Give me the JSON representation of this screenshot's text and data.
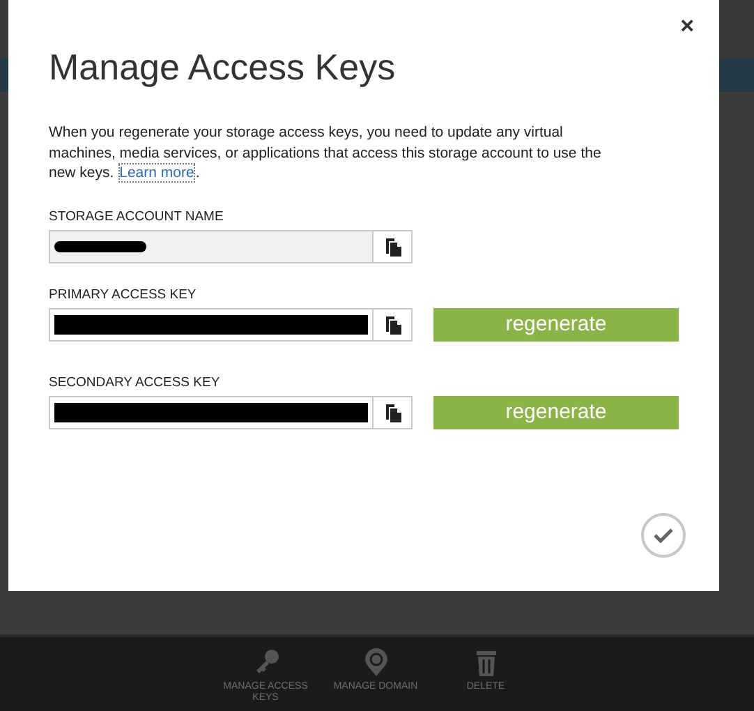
{
  "dialog": {
    "title": "Manage Access Keys",
    "close": "×",
    "description": "When you regenerate your storage access keys, you need to update any virtual machines, media services, or applications that access this storage account to use the new keys.",
    "link": "Learn more",
    "link_after": ".",
    "fields": [
      {
        "label": "STORAGE ACCOUNT NAME",
        "readonly": true
      },
      {
        "label": "PRIMARY ACCESS KEY",
        "readonly": false,
        "regenerate": "regenerate"
      },
      {
        "label": "SECONDARY ACCESS KEY",
        "readonly": false,
        "regenerate": "regenerate"
      }
    ]
  },
  "command_bar": [
    {
      "kind": "key",
      "label": "MANAGE ACCESS KEYS"
    },
    {
      "kind": "domain",
      "label": "MANAGE DOMAIN"
    },
    {
      "kind": "delete",
      "label": "DELETE"
    }
  ]
}
